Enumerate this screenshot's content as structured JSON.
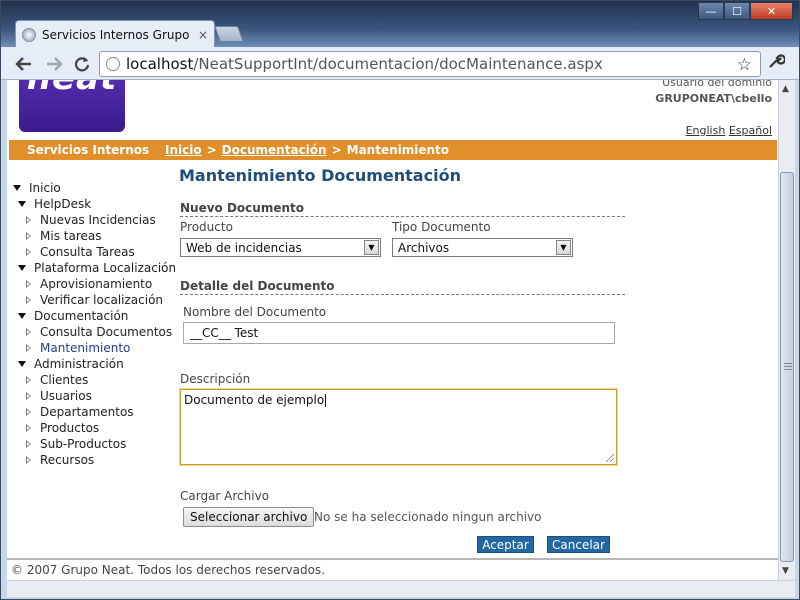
{
  "browser": {
    "tab_title": "Servicios Internos Grupo Ne",
    "tab_close": "×",
    "url_host": "localhost",
    "url_path": "/NeatSupportInt/documentacion/docMaintenance.aspx",
    "back_icon": "back-arrow-icon",
    "forward_icon": "forward-arrow-icon",
    "reload_icon": "reload-icon",
    "window_buttons": {
      "minimize": "—",
      "maximize": "☐",
      "close": "✕"
    }
  },
  "header": {
    "logo_text": "neat",
    "user_label": "Usuario del dominio",
    "user_value": "GRUPONEAT\\cbello",
    "lang_en": "English",
    "lang_es": "Español"
  },
  "navbar": {
    "site_name": "Servicios Internos",
    "breadcrumb": [
      "Inicio",
      "Documentación",
      "Mantenimiento"
    ],
    "separator": ">",
    "color": "#e08f2b"
  },
  "sidebar": {
    "items": [
      {
        "label": "Inicio",
        "level": 0,
        "expanded": true
      },
      {
        "label": "HelpDesk",
        "level": 1,
        "expanded": true
      },
      {
        "label": "Nuevas Incidencias",
        "level": 2
      },
      {
        "label": "Mis tareas",
        "level": 2
      },
      {
        "label": "Consulta Tareas",
        "level": 2
      },
      {
        "label": "Plataforma Localización",
        "level": 1,
        "expanded": true
      },
      {
        "label": "Aprovisionamiento",
        "level": 2
      },
      {
        "label": "Verificar localización",
        "level": 2
      },
      {
        "label": "Documentación",
        "level": 1,
        "expanded": true
      },
      {
        "label": "Consulta Documentos",
        "level": 2
      },
      {
        "label": "Mantenimiento",
        "level": 2,
        "selected": true
      },
      {
        "label": "Administración",
        "level": 1,
        "expanded": true
      },
      {
        "label": "Clientes",
        "level": 2
      },
      {
        "label": "Usuarios",
        "level": 2
      },
      {
        "label": "Departamentos",
        "level": 2
      },
      {
        "label": "Productos",
        "level": 2
      },
      {
        "label": "Sub-Productos",
        "level": 2
      },
      {
        "label": "Recursos",
        "level": 2
      }
    ]
  },
  "main": {
    "title": "Mantenimiento Documentación",
    "new_doc_section": "Nuevo Documento",
    "product_label": "Producto",
    "product_value": "Web de incidencias",
    "doc_type_label": "Tipo Documento",
    "doc_type_value": "Archivos",
    "detail_section": "Detalle del Documento",
    "doc_name_label": "Nombre del Documento",
    "doc_name_value": "__CC__ Test",
    "description_label": "Descripción",
    "description_value": "Documento de ejemplo",
    "upload_label": "Cargar Archivo",
    "upload_button": "Seleccionar archivo",
    "upload_note": "No se ha seleccionado ningun archivo",
    "accept_button": "Aceptar",
    "cancel_button": "Cancelar"
  },
  "footer": {
    "copyright": "© 2007 Grupo Neat. Todos los derechos reservados."
  }
}
